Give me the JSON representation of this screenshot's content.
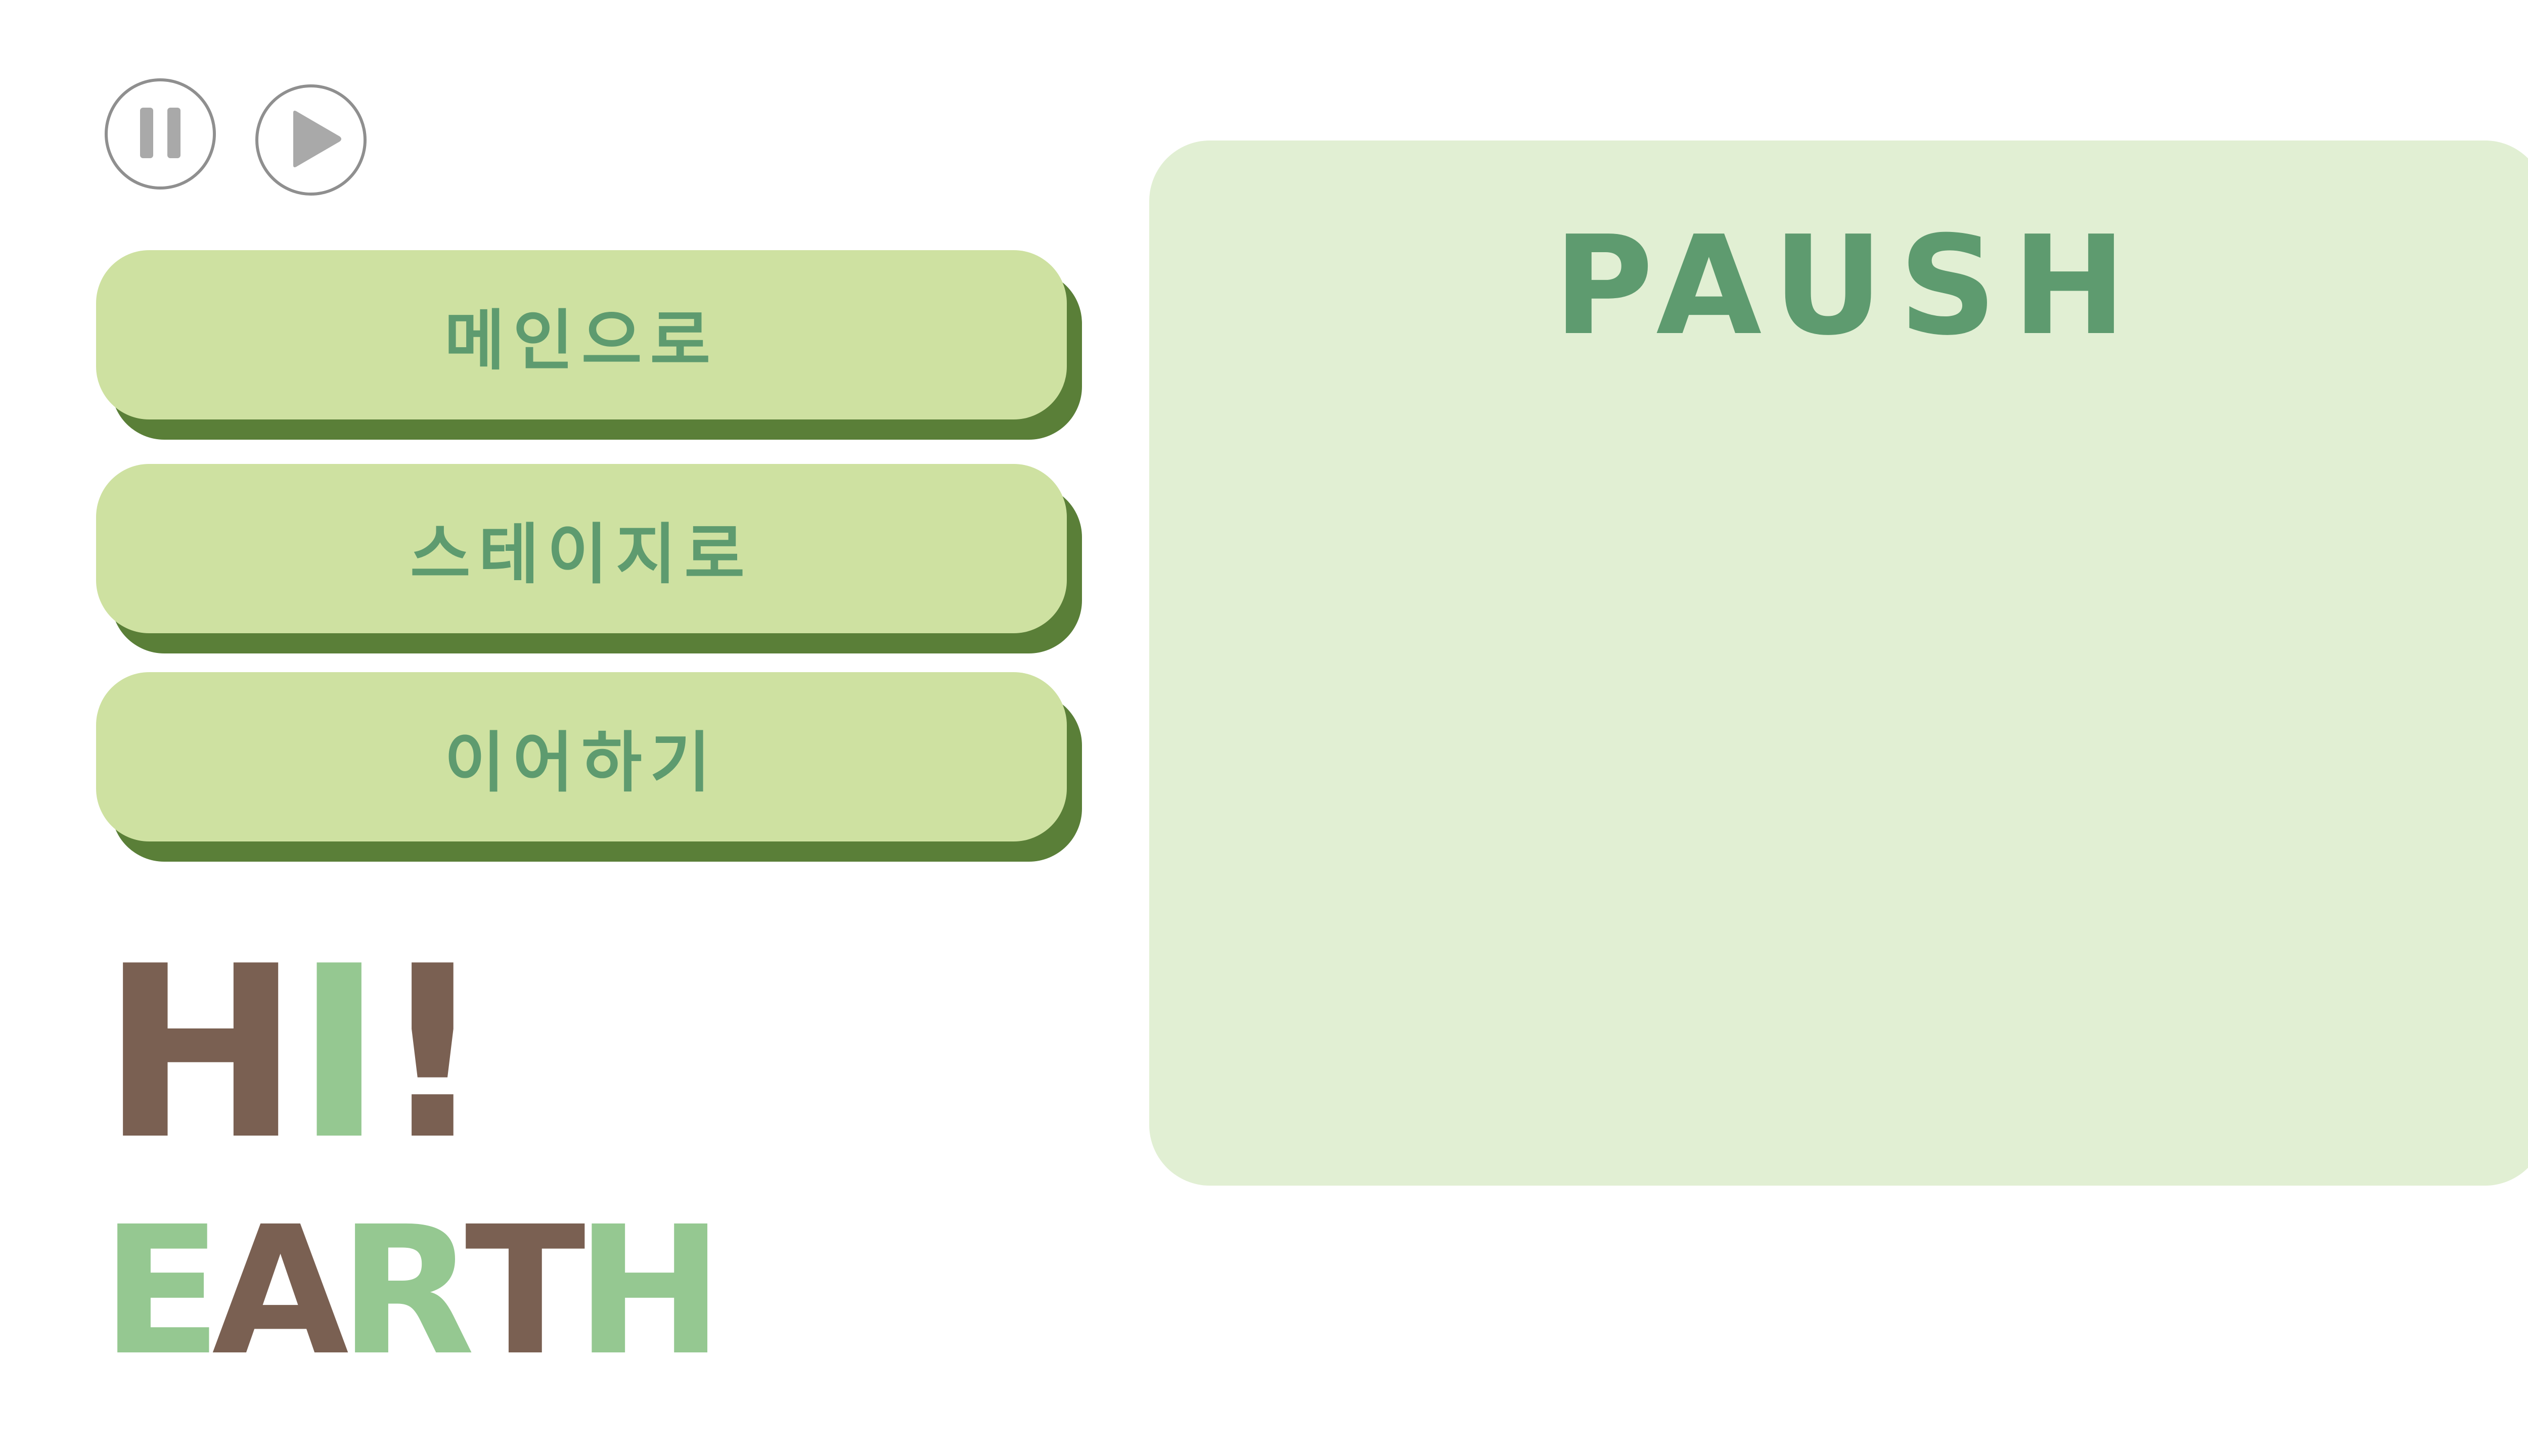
{
  "controls": {
    "pause_icon": "pause-icon",
    "play_icon": "play-icon",
    "icon_color": "#a9a9a9"
  },
  "menu": {
    "main_label": "메인으로",
    "stage_label": "스테이지로",
    "continue_label": "이어하기"
  },
  "panel": {
    "title": "PAUSH"
  },
  "logo": {
    "h": "H",
    "i": "I",
    "exclaim": "!",
    "e": "E",
    "a": "A",
    "r": "R",
    "t": "T",
    "h2": "H"
  },
  "colors": {
    "button_face": "#cee1a1",
    "button_shadow": "#5a7f38",
    "text_green": "#5e9b6f",
    "panel_bg": "#e1efd3",
    "logo_brown": "#7a6052",
    "logo_green": "#95c891"
  }
}
